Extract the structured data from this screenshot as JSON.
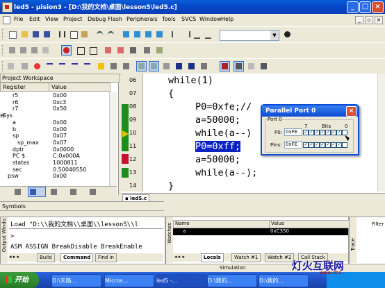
{
  "title": "led5 - µVision3 - [D:\\我的文档\\桌面\\lesson5\\led5.c]",
  "title_display": "led5 - μision3 - [D:\\我的文档\\桌面\\lesson5\\led5.c]",
  "menu": [
    "File",
    "Edit",
    "View",
    "Project",
    "Debug",
    "Flash",
    "Peripherals",
    "Tools",
    "SVCS",
    "Window",
    "Help"
  ],
  "workspace": {
    "caption": "Project Workspace",
    "col_register": "Register",
    "col_value": "Value",
    "registers": [
      {
        "name": "r5",
        "value": "0x00",
        "indent": 2
      },
      {
        "name": "r6",
        "value": "0xc3",
        "indent": 2
      },
      {
        "name": "r7",
        "value": "0x50",
        "indent": 2
      },
      {
        "name": "Sys",
        "value": "",
        "indent": 0
      },
      {
        "name": "a",
        "value": "0x00",
        "indent": 2
      },
      {
        "name": "b",
        "value": "0x00",
        "indent": 2
      },
      {
        "name": "sp",
        "value": "0x07",
        "indent": 2
      },
      {
        "name": "sp_max",
        "value": "0x07",
        "indent": 3
      },
      {
        "name": "dptr",
        "value": "0x0000",
        "indent": 2
      },
      {
        "name": "PC  $",
        "value": "C:0x000A",
        "indent": 2
      },
      {
        "name": "states",
        "value": "1000811",
        "indent": 2
      },
      {
        "name": "sec",
        "value": "0.50040550",
        "indent": 2
      },
      {
        "name": "psw",
        "value": "0x00",
        "indent": 1
      }
    ]
  },
  "editor": {
    "tab": "led5.c",
    "lines": [
      {
        "num": "06",
        "text": "while(1)",
        "indent": 0
      },
      {
        "num": "07",
        "text": "{",
        "indent": 0
      },
      {
        "num": "08",
        "text": "P0=0xfe;//",
        "indent": 1
      },
      {
        "num": "09",
        "text": "a=50000;",
        "indent": 1
      },
      {
        "num": "10",
        "text": "while(a--)",
        "indent": 1
      },
      {
        "num": "11",
        "text": "P0=0xff;",
        "indent": 1
      },
      {
        "num": "12",
        "text": "a=50000;",
        "indent": 1
      },
      {
        "num": "13",
        "text": "while(a--);",
        "indent": 1
      },
      {
        "num": "14",
        "text": "}",
        "indent": 0
      }
    ]
  },
  "parallel_port": {
    "title": "Parallel Port 0",
    "group": "Port 0",
    "bits_label": "Bits",
    "bit_high": "7",
    "bit_low": "0",
    "p0_label": "P0:",
    "p0_value": "0xFE",
    "pins_label": "Pins:",
    "pins_value": "0xFE"
  },
  "symbols_caption": "Symbols",
  "output": {
    "side_caption": "Output Windo",
    "lines": [
      "Load \"D:\\\\我的文档\\\\桌面\\\\lesson5\\\\l",
      ">",
      "ASM ASSIGN BreakDisable BreakEnable"
    ],
    "tabs": [
      "Build",
      "Command",
      "Find in"
    ]
  },
  "watch": {
    "side_caption": "Watches",
    "col_name": "Name",
    "col_value": "Value",
    "row_name": "a",
    "row_value": "0xC350",
    "tabs": [
      "Locals",
      "Watch #1",
      "Watch #2",
      "Call Stack"
    ]
  },
  "trace": {
    "filter": "Filter",
    "caption": "Trace"
  },
  "status": {
    "mode": "Simulation"
  },
  "taskbar": {
    "start": "开始",
    "items": [
      "D:\\天路...",
      "Micros...",
      "led5 -...",
      "D:\\我的...",
      "D:\\我的..."
    ]
  },
  "watermark": {
    "text": "灯火互联网",
    "site": "www.dhz..."
  },
  "colors": {
    "title_blue": "#0546c8",
    "highlight": "#0a24c4",
    "number_red": "#d21",
    "breakpoint_red": "#c8102e",
    "coverage_green": "#1a8f1a"
  }
}
